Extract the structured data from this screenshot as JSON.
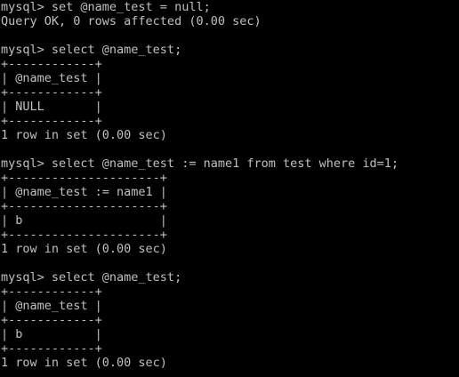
{
  "terminal": {
    "colors": {
      "background": "#000000",
      "foreground": "#c0c0c0"
    },
    "lines": [
      "mysql> set @name_test = null;",
      "Query OK, 0 rows affected (0.00 sec)",
      "",
      "mysql> select @name_test;",
      "+------------+",
      "| @name_test |",
      "+------------+",
      "| NULL       |",
      "+------------+",
      "1 row in set (0.00 sec)",
      "",
      "mysql> select @name_test := name1 from test where id=1;",
      "+---------------------+",
      "| @name_test := name1 |",
      "+---------------------+",
      "| b                   |",
      "+---------------------+",
      "1 row in set (0.00 sec)",
      "",
      "mysql> select @name_test;",
      "+------------+",
      "| @name_test |",
      "+------------+",
      "| b          |",
      "+------------+",
      "1 row in set (0.00 sec)"
    ]
  }
}
